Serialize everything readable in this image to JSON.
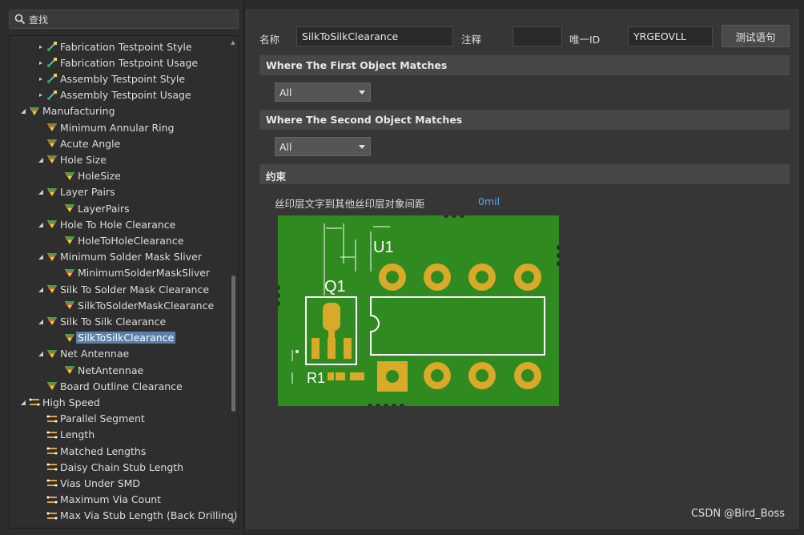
{
  "search": {
    "placeholder": "查找"
  },
  "tree": {
    "rows": [
      {
        "label": "Fabrication Testpoint Style",
        "indent": 2,
        "arrow": "▸",
        "icon": "testpoint"
      },
      {
        "label": "Fabrication Testpoint Usage",
        "indent": 2,
        "arrow": "▸",
        "icon": "testpoint"
      },
      {
        "label": "Assembly Testpoint Style",
        "indent": 2,
        "arrow": "▸",
        "icon": "testpoint"
      },
      {
        "label": "Assembly Testpoint Usage",
        "indent": 2,
        "arrow": "▸",
        "icon": "testpoint"
      },
      {
        "label": "Manufacturing",
        "indent": 1,
        "arrow": "◢",
        "icon": "rule"
      },
      {
        "label": "Minimum Annular Ring",
        "indent": 2,
        "arrow": "",
        "icon": "rule"
      },
      {
        "label": "Acute Angle",
        "indent": 2,
        "arrow": "",
        "icon": "rule"
      },
      {
        "label": "Hole Size",
        "indent": 2,
        "arrow": "◢",
        "icon": "rule"
      },
      {
        "label": "HoleSize",
        "indent": 3,
        "arrow": "",
        "icon": "rule"
      },
      {
        "label": "Layer Pairs",
        "indent": 2,
        "arrow": "◢",
        "icon": "rule"
      },
      {
        "label": "LayerPairs",
        "indent": 3,
        "arrow": "",
        "icon": "rule"
      },
      {
        "label": "Hole To Hole Clearance",
        "indent": 2,
        "arrow": "◢",
        "icon": "rule"
      },
      {
        "label": "HoleToHoleClearance",
        "indent": 3,
        "arrow": "",
        "icon": "rule"
      },
      {
        "label": "Minimum Solder Mask Sliver",
        "indent": 2,
        "arrow": "◢",
        "icon": "rule"
      },
      {
        "label": "MinimumSolderMaskSliver",
        "indent": 3,
        "arrow": "",
        "icon": "rule"
      },
      {
        "label": "Silk To Solder Mask Clearance",
        "indent": 2,
        "arrow": "◢",
        "icon": "rule"
      },
      {
        "label": "SilkToSolderMaskClearance",
        "indent": 3,
        "arrow": "",
        "icon": "rule"
      },
      {
        "label": "Silk To Silk Clearance",
        "indent": 2,
        "arrow": "◢",
        "icon": "rule"
      },
      {
        "label": "SilkToSilkClearance",
        "indent": 3,
        "arrow": "",
        "icon": "rule",
        "selected": true
      },
      {
        "label": "Net Antennae",
        "indent": 2,
        "arrow": "◢",
        "icon": "rule"
      },
      {
        "label": "NetAntennae",
        "indent": 3,
        "arrow": "",
        "icon": "rule"
      },
      {
        "label": "Board Outline Clearance",
        "indent": 2,
        "arrow": "",
        "icon": "rule"
      },
      {
        "label": "High Speed",
        "indent": 1,
        "arrow": "◢",
        "icon": "highspeed"
      },
      {
        "label": "Parallel Segment",
        "indent": 2,
        "arrow": "",
        "icon": "highspeed"
      },
      {
        "label": "Length",
        "indent": 2,
        "arrow": "",
        "icon": "highspeed"
      },
      {
        "label": "Matched Lengths",
        "indent": 2,
        "arrow": "",
        "icon": "highspeed"
      },
      {
        "label": "Daisy Chain Stub Length",
        "indent": 2,
        "arrow": "",
        "icon": "highspeed"
      },
      {
        "label": "Vias Under SMD",
        "indent": 2,
        "arrow": "",
        "icon": "highspeed"
      },
      {
        "label": "Maximum Via Count",
        "indent": 2,
        "arrow": "",
        "icon": "highspeed"
      },
      {
        "label": "Max Via Stub Length (Back Drilling)",
        "indent": 2,
        "arrow": "",
        "icon": "highspeed"
      }
    ]
  },
  "form": {
    "name_label": "名称",
    "name_value": "SilkToSilkClearance",
    "comment_label": "注释",
    "comment_value": "",
    "uid_label": "唯一ID",
    "uid_value": "YRGEOVLL",
    "test_button": "测试语句"
  },
  "sections": {
    "first": "Where The First Object Matches",
    "first_value": "All",
    "second": "Where The Second Object Matches",
    "second_value": "All",
    "constraints": "约束"
  },
  "constraint": {
    "label": "丝印层文字到其他丝印层对象间距",
    "value": "0mil"
  },
  "pcb": {
    "u1": "U1",
    "q1": "Q1",
    "r1": "R1"
  },
  "colors": {
    "board": "#2f8a1f",
    "pad": "#d9a92a",
    "selection": "#5a7fa8",
    "value_blue": "#5aa8e0"
  },
  "watermark": "CSDN @Bird_Boss"
}
